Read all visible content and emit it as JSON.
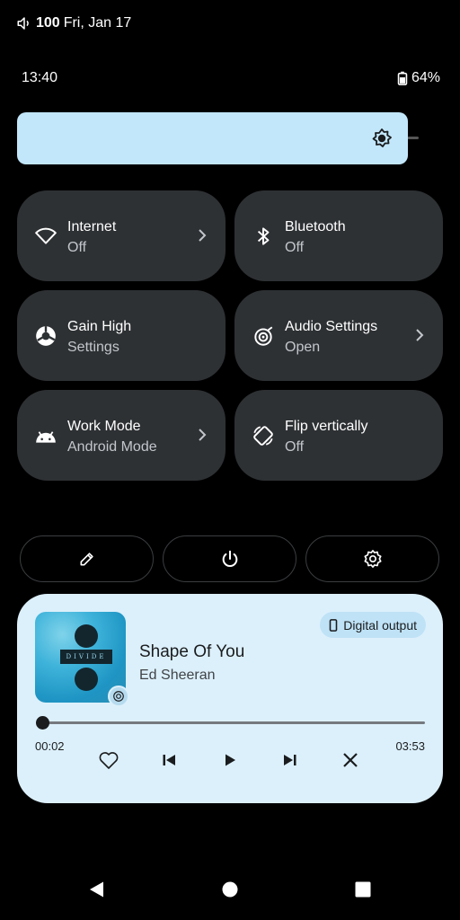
{
  "status_bar": {
    "volume": "100",
    "date": "Fri, Jan 17",
    "time": "13:40",
    "battery": "64%"
  },
  "brightness": {
    "icon": "brightness-icon",
    "level": 0.95
  },
  "tiles": [
    {
      "title": "Internet",
      "subtitle": "Off",
      "icon": "wifi-icon",
      "has_chevron": true
    },
    {
      "title": "Bluetooth",
      "subtitle": "Off",
      "icon": "bluetooth-icon",
      "has_chevron": false
    },
    {
      "title": "Gain High",
      "subtitle": "Settings",
      "icon": "gain-icon",
      "has_chevron": false
    },
    {
      "title": "Audio Settings",
      "subtitle": "Open",
      "icon": "audio-settings-icon",
      "has_chevron": true
    },
    {
      "title": "Work Mode",
      "subtitle": "Android Mode",
      "icon": "android-icon",
      "has_chevron": true
    },
    {
      "title": "Flip vertically",
      "subtitle": "Off",
      "icon": "rotate-icon",
      "has_chevron": false
    }
  ],
  "actions": [
    {
      "icon": "edit-icon"
    },
    {
      "icon": "power-icon"
    },
    {
      "icon": "settings-icon"
    }
  ],
  "media": {
    "output_label": "Digital output",
    "album_text": "DIVIDE",
    "song": "Shape Of You",
    "artist": "Ed Sheeran",
    "elapsed": "00:02",
    "duration": "03:53",
    "progress": 0.01,
    "colors": {
      "card": "#dcf0fb",
      "accent": "#1a1c1e"
    }
  },
  "nav": {
    "back": "back-icon",
    "home": "home-icon",
    "recents": "recents-icon"
  }
}
